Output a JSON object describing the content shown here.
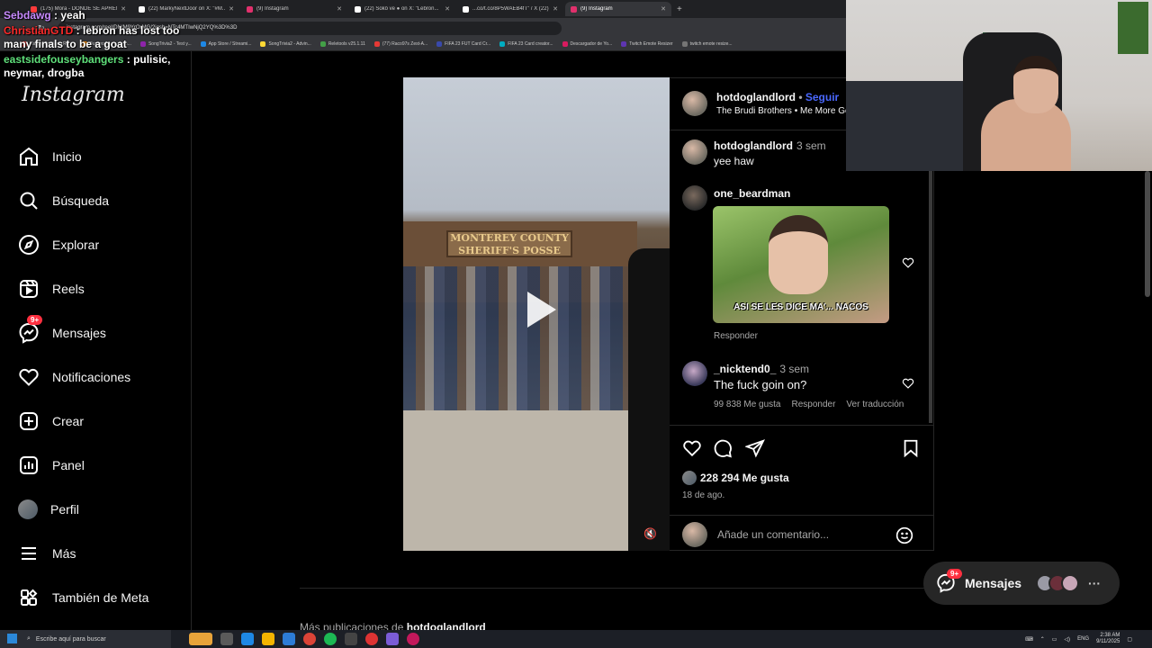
{
  "browser": {
    "tabs": [
      {
        "label": "(175) Mora - DONDE SE APREN...",
        "color": "#ff3b3b"
      },
      {
        "label": "(22) MarkyNextDoor on X: \"#M...",
        "color": "#ffffff"
      },
      {
        "label": "(9) Instagram",
        "color": "#e1306c"
      },
      {
        "label": "(22) Sokô ve ● on X: \"Lebron...",
        "color": "#ffffff"
      },
      {
        "label": "...co/t.co/8P5WAEB4fT\" / X (22)",
        "color": "#ffffff"
      },
      {
        "label": "(9) Instagram",
        "color": "#e1306c",
        "active": true
      }
    ],
    "url": "instagram.com/reel/DN/M9YrOrMG/?igsh=NTc4MTIwNjQ2YQ%3D%3D",
    "bookmarks": [
      "Happy Cristiano Ro...",
      "Burago figura de lo...",
      "SongTrivia2 - Test y...",
      "App Store / Streami...",
      "SongTrivia2 - Advin...",
      "Reletools v25.1.11",
      "(77) Raco97s Zest-A...",
      "FIFA 23 FUT Card Cr...",
      "FIFA 23 Card creator...",
      "Descargador de Yo...",
      "Twitch Emote Resizer",
      "twitch emote resize..."
    ]
  },
  "chat": [
    {
      "user": "Sebdawg",
      "color": "#c88bff",
      "text": "yeah"
    },
    {
      "user": "ChristianGTD",
      "color": "#ff2a2a",
      "text": "lebron has lost too many finals to be a goat"
    },
    {
      "user": "eastsidefouseybangers",
      "color": "#5fe07a",
      "text": "pulisic, neymar, drogba"
    }
  ],
  "sidebar": {
    "logo": "Instagram",
    "messages_badge": "9+",
    "items": [
      {
        "label": "Inicio",
        "icon": "home-icon"
      },
      {
        "label": "Búsqueda",
        "icon": "search-icon"
      },
      {
        "label": "Explorar",
        "icon": "compass-icon"
      },
      {
        "label": "Reels",
        "icon": "reels-icon"
      },
      {
        "label": "Mensajes",
        "icon": "messenger-icon"
      },
      {
        "label": "Notificaciones",
        "icon": "heart-icon"
      },
      {
        "label": "Crear",
        "icon": "plus-square-icon"
      },
      {
        "label": "Panel",
        "icon": "chart-icon"
      },
      {
        "label": "Perfil",
        "icon": "avatar"
      },
      {
        "label": "Más",
        "icon": "menu-icon"
      },
      {
        "label": "También de Meta",
        "icon": "meta-icon"
      }
    ]
  },
  "video": {
    "sign_line1": "MONTEREY COUNTY",
    "sign_line2": "SHERIFF'S POSSE"
  },
  "post": {
    "author": "hotdoglandlord",
    "follow": "Seguir",
    "audio": "The Brudi Brothers • Me More Go",
    "caption_author": "hotdoglandlord",
    "caption_time": "3 sem",
    "caption": "yee haw",
    "comments": [
      {
        "user": "one_beardman",
        "gif_caption": "ASI SE LES DICE MA'... NACOS",
        "reply": "Responder"
      },
      {
        "user": "_nicktend0_",
        "time": "3 sem",
        "text": "The fuck goin on?",
        "likes": "99 838 Me gusta",
        "reply": "Responder",
        "translate": "Ver traducción"
      }
    ],
    "like_count": "228 294 Me gusta",
    "date": "18 de ago.",
    "comment_placeholder": "Añade un comentario..."
  },
  "more_posts_prefix": "Más publicaciones de",
  "more_posts_user": "hotdoglandlord",
  "messages_pill": {
    "label": "Mensajes",
    "badge": "9+"
  },
  "taskbar": {
    "search_placeholder": "Escribe aquí para buscar",
    "lang": "ENG",
    "time": "2:38 AM",
    "date": "9/11/2025"
  }
}
